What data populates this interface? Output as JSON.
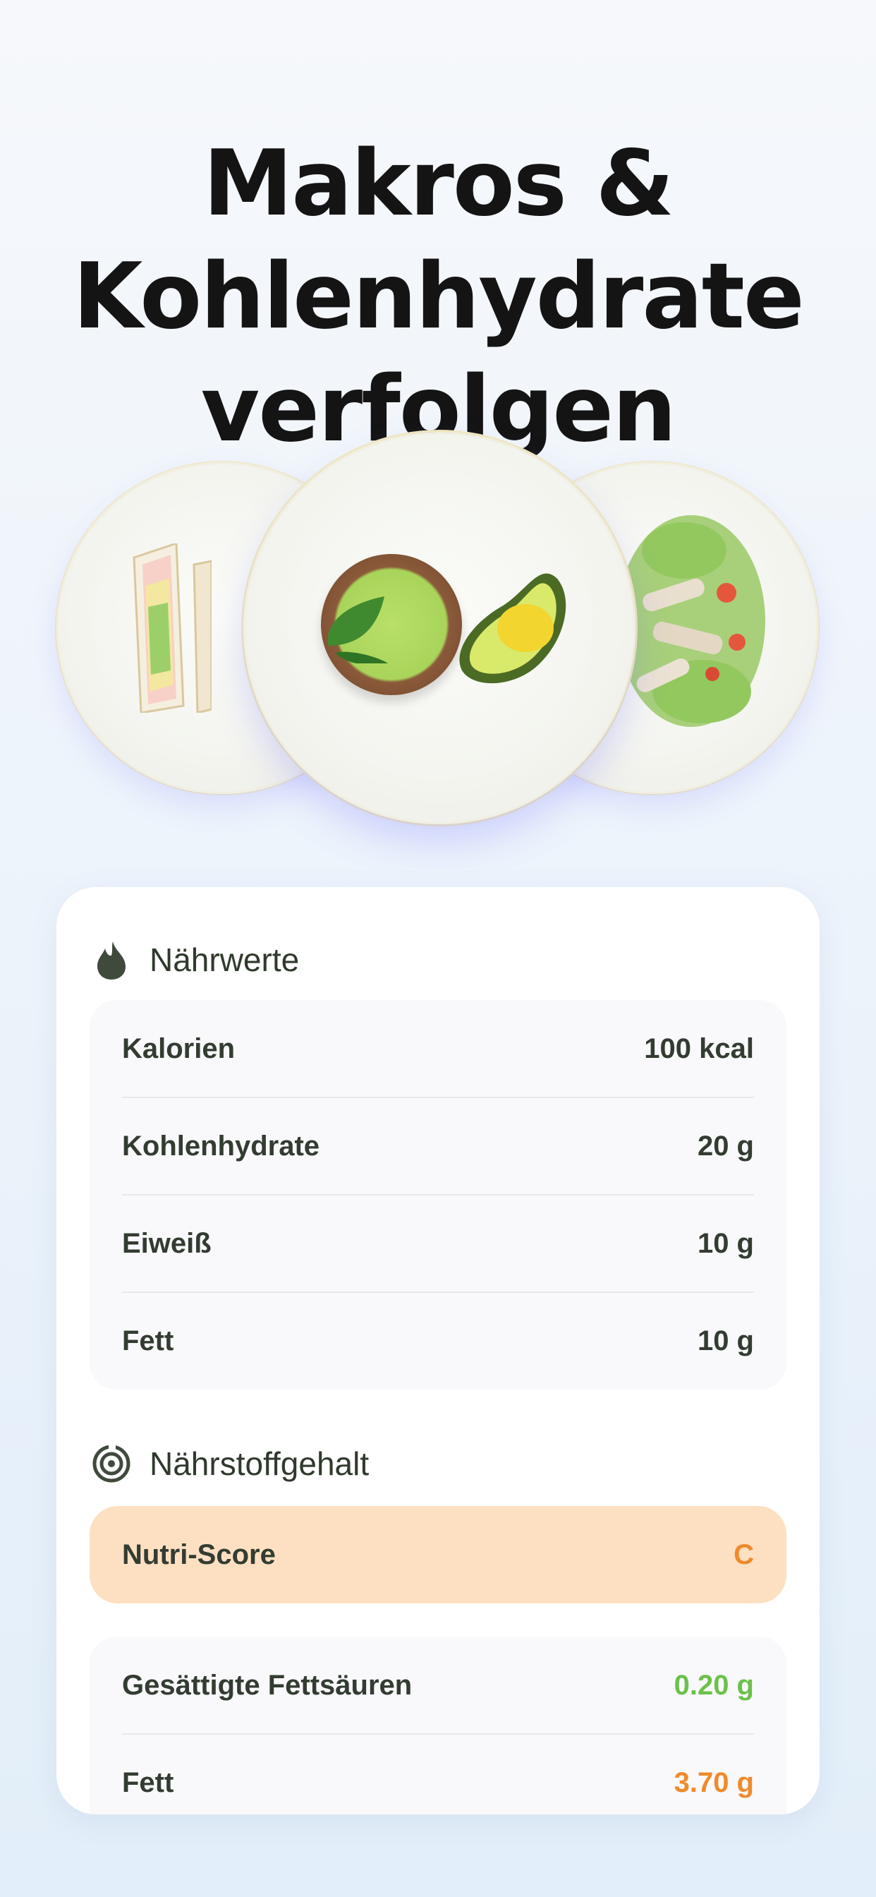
{
  "headline": {
    "line1": "Makros &",
    "line2": "Kohlenhydrate",
    "line3": "verfolgen"
  },
  "plates": [
    "sandwich",
    "guacamole-and-avocado",
    "chicken-salad"
  ],
  "nutrition": {
    "title": "Nährwerte",
    "icon": "flame-icon",
    "rows": [
      {
        "label": "Kalorien",
        "value": "100 kcal"
      },
      {
        "label": "Kohlenhydrate",
        "value": "20 g"
      },
      {
        "label": "Eiweiß",
        "value": "10 g"
      },
      {
        "label": "Fett",
        "value": "10 g"
      }
    ]
  },
  "content": {
    "title": "Nährstoffgehalt",
    "icon": "target-icon",
    "nutri_score": {
      "label": "Nutri-Score",
      "value": "C",
      "color": "#f08a2a",
      "background": "#fde0c1"
    },
    "rows": [
      {
        "label": "Gesättigte Fettsäuren",
        "value": "0.20 g",
        "color": "#6bc14a"
      },
      {
        "label": "Fett",
        "value": "3.70 g",
        "color": "#f08a2a"
      }
    ]
  }
}
